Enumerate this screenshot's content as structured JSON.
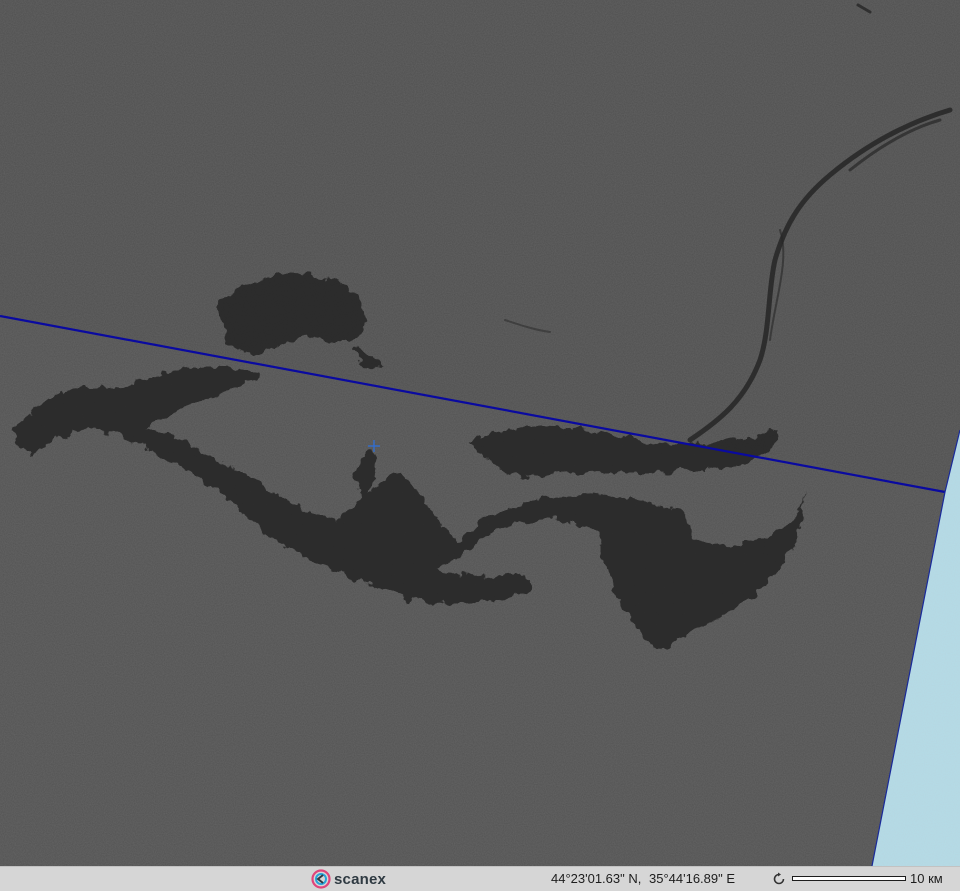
{
  "map": {
    "image_type": "satellite-radar-scene",
    "water_color": "#505050",
    "land_color": "#b4dce8",
    "scene_boundary_color": "#0a0aa0",
    "cursor_color": "#2f6fd8"
  },
  "status_bar": {
    "logo_text": "scanex",
    "latitude": "44°23'01.63\" N,",
    "longitude": "35°44'16.89\" E",
    "coord_toggle_icon": "refresh-icon",
    "scale_label": "10 км"
  }
}
